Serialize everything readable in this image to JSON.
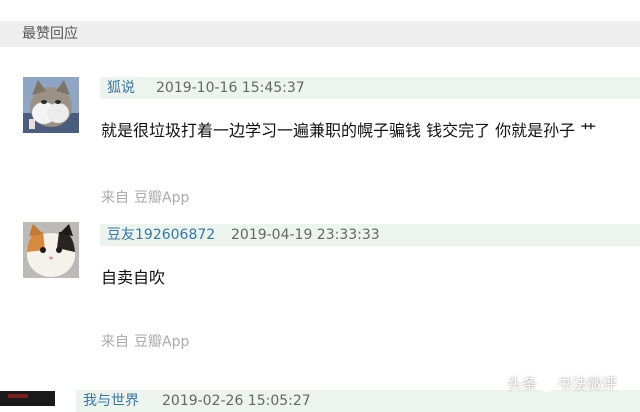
{
  "section": {
    "title": "最赞回应"
  },
  "comments": [
    {
      "author": "狐说",
      "time": "2019-10-16 15:45:37",
      "content": "就是很垃圾打着一边学习一遍兼职的幌子骗钱 钱交完了 你就是孙子 艹",
      "source_prefix": "来自",
      "source_app": "豆瓣App",
      "avatar_icon": "cat-avatar-icon"
    },
    {
      "author": "豆友192606872",
      "time": "2019-04-19 23:33:33",
      "content": "自卖自吹",
      "source_prefix": "来自",
      "source_app": "豆瓣App",
      "avatar_icon": "calico-cat-avatar-icon"
    },
    {
      "author": "我与世界",
      "time": "2019-02-26 15:05:27",
      "avatar_icon": "dark-avatar-icon"
    }
  ],
  "watermark": {
    "prefix": "头条",
    "name": "书法微评"
  },
  "colors": {
    "header_bg": "#eeeeee",
    "meta_bg": "#edf4ed",
    "author_link": "#3377aa",
    "muted": "#aaaaaa"
  }
}
